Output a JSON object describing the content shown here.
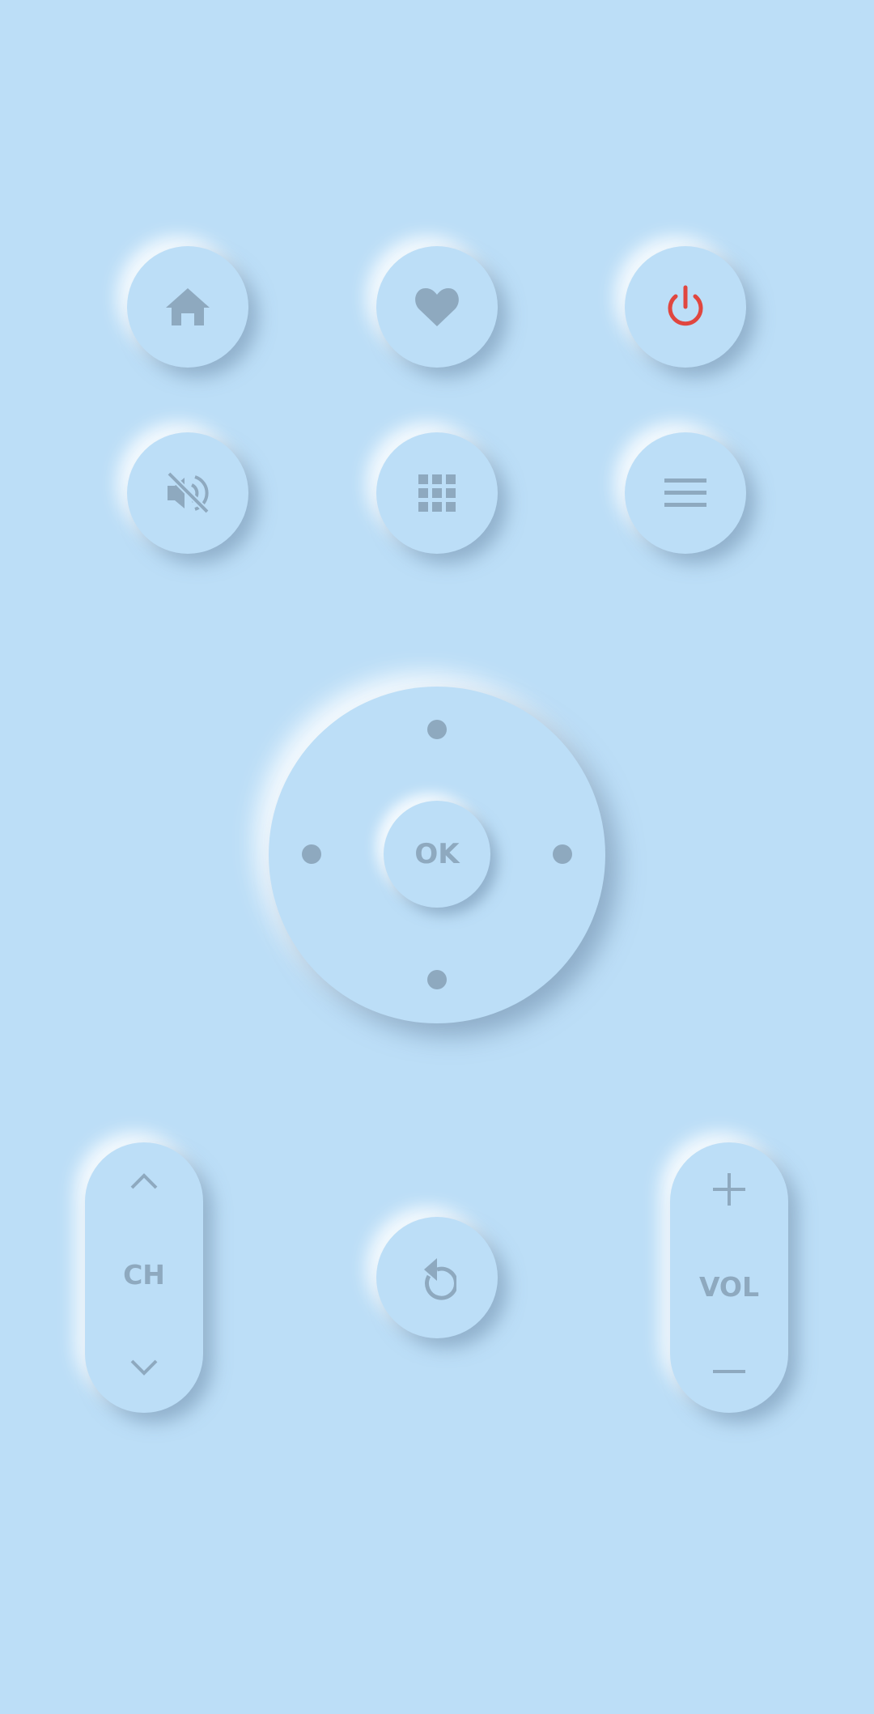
{
  "colors": {
    "background": "#bcdef7",
    "icon": "#8ea9bf",
    "power_accent": "#e0463f"
  },
  "icons": {
    "home": "home-icon",
    "favorite": "heart-icon",
    "power": "power-icon",
    "mute": "volume-mute-icon",
    "apps": "apps-grid-icon",
    "menu": "menu-icon",
    "back": "back-icon",
    "channel_up": "chevron-up-icon",
    "channel_down": "chevron-down-icon",
    "volume_up": "plus-icon",
    "volume_down": "minus-icon"
  },
  "dpad": {
    "ok_label": "OK"
  },
  "channel": {
    "label": "CH"
  },
  "volume": {
    "label": "VOL"
  }
}
